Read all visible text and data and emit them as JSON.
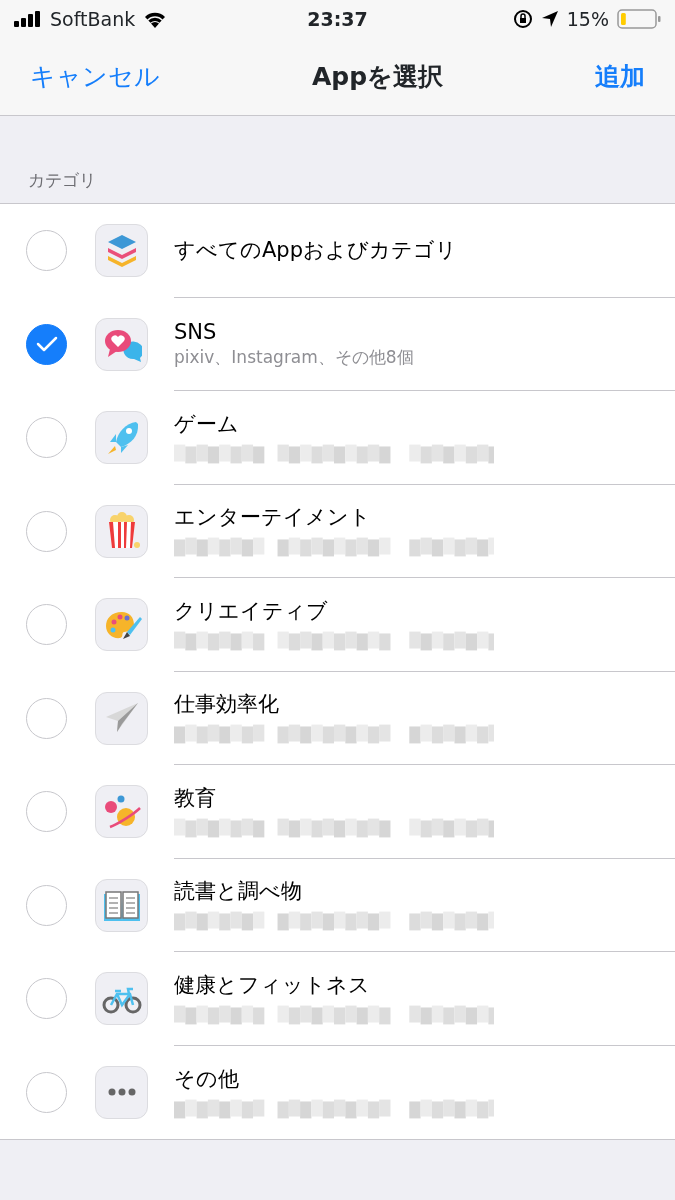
{
  "status_bar": {
    "carrier": "SoftBank",
    "time": "23:37",
    "battery": "15%",
    "battery_meter": {
      "level": 0.15
    }
  },
  "nav": {
    "cancel": "キャンセル",
    "title": "Appを選択",
    "add": "追加"
  },
  "section_header": "カテゴリ",
  "categories": [
    {
      "title": "すべてのAppおよびカテゴリ",
      "selected": false
    },
    {
      "title": "SNS",
      "subtitle": "pixiv、Instagram、その他8個",
      "selected": true
    },
    {
      "title": "ゲーム",
      "redacted": true,
      "selected": false
    },
    {
      "title": "エンターテイメント",
      "redacted": true,
      "selected": false
    },
    {
      "title": "クリエイティブ",
      "redacted": true,
      "selected": false
    },
    {
      "title": "仕事効率化",
      "redacted": true,
      "selected": false
    },
    {
      "title": "教育",
      "redacted": true,
      "selected": false
    },
    {
      "title": "読書と調べ物",
      "redacted": true,
      "selected": false
    },
    {
      "title": "健康とフィットネス",
      "redacted": true,
      "selected": false
    },
    {
      "title": "その他",
      "redacted": true,
      "selected": false
    }
  ]
}
